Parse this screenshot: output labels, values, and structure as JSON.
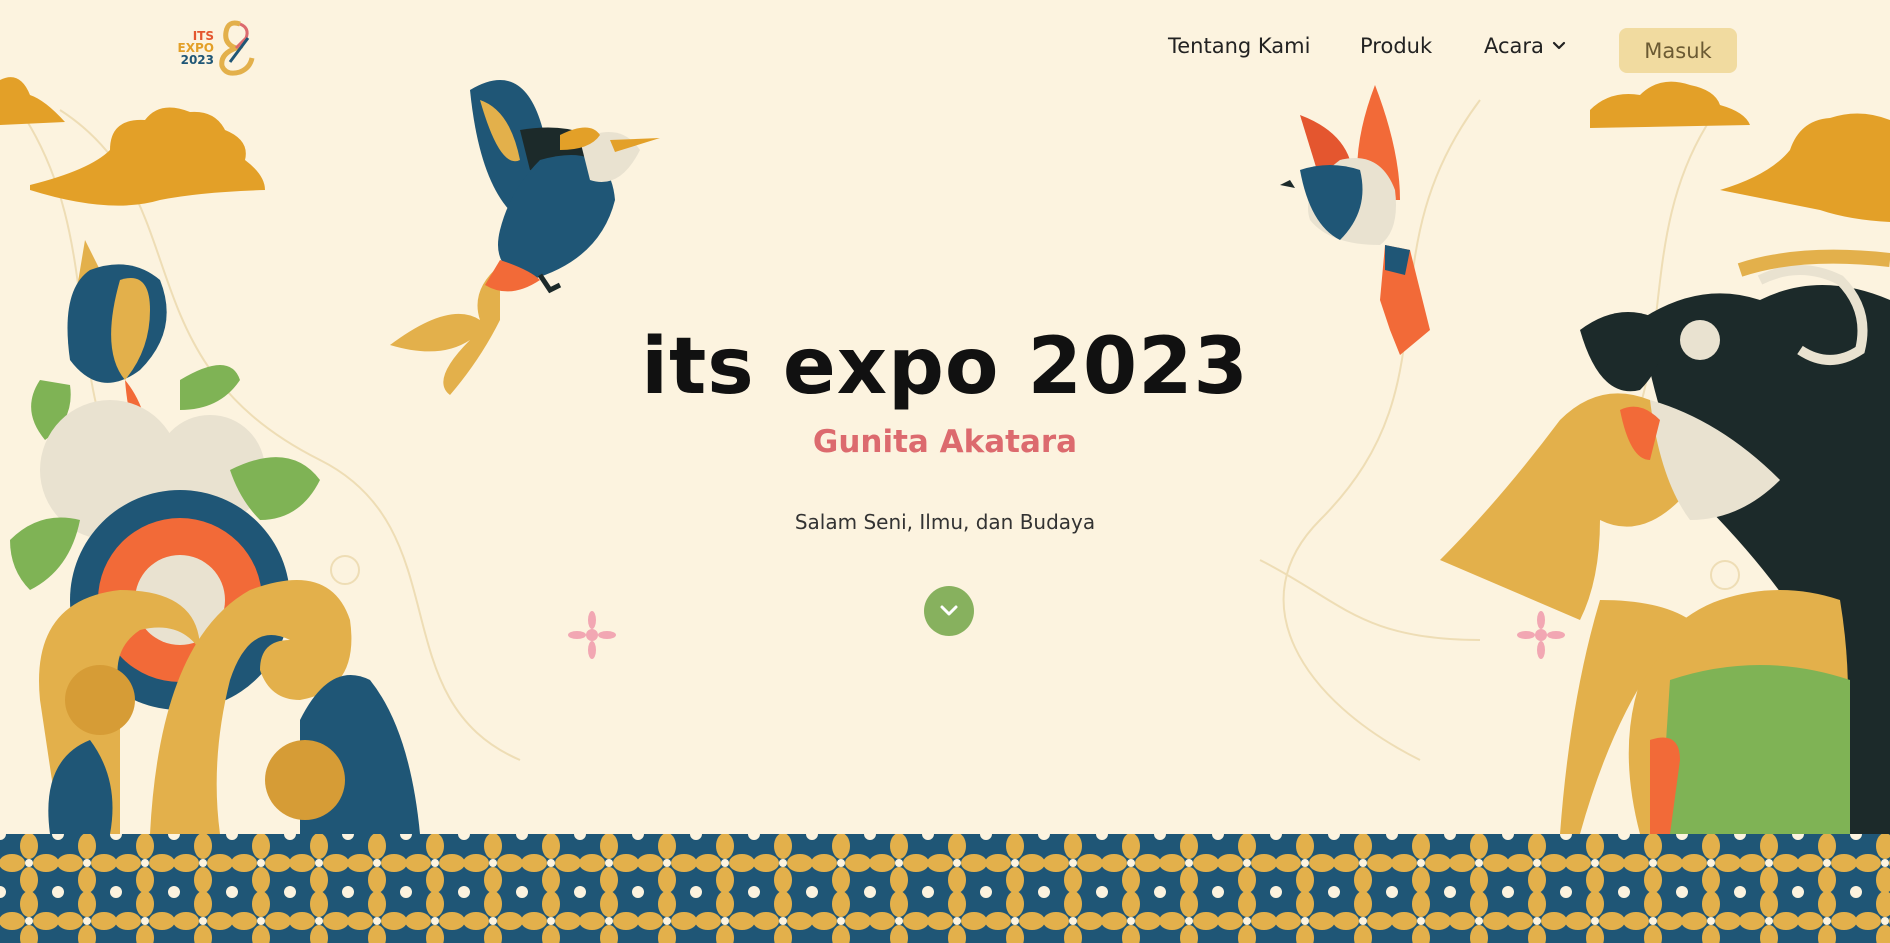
{
  "logo": {
    "line1": "ITS",
    "line2": "EXPO",
    "line3": "2023"
  },
  "nav": {
    "about_label": "Tentang Kami",
    "products_label": "Produk",
    "events_label": "Acara",
    "login_label": "Masuk"
  },
  "hero": {
    "title": "its expo 2023",
    "subtitle": "Gunita Akatara",
    "tagline": "Salam Seni, Ilmu, dan Budaya"
  },
  "colors": {
    "background": "#FCF3DF",
    "accent_pink": "#DC6A6E",
    "accent_green": "#87B15E",
    "gold": "#E3B04B",
    "navy": "#1F5676",
    "orange": "#F26A38",
    "button_bg": "#F1DBA0"
  },
  "icons": {
    "dropdown": "chevron-down-icon",
    "scroll": "chevron-down-icon"
  }
}
